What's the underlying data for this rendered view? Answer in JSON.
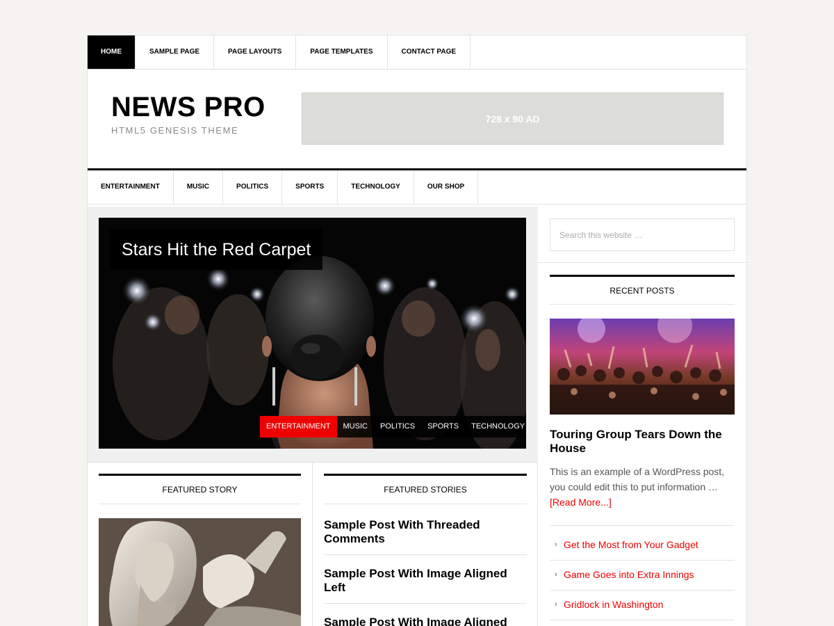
{
  "top_nav": {
    "items": [
      {
        "label": "HOME"
      },
      {
        "label": "SAMPLE PAGE"
      },
      {
        "label": "PAGE LAYOUTS"
      },
      {
        "label": "PAGE TEMPLATES"
      },
      {
        "label": "CONTACT PAGE"
      }
    ]
  },
  "header": {
    "title": "NEWS PRO",
    "tagline": "HTML5 GENESIS THEME",
    "ad_label": "728 x 90 AD"
  },
  "secondary_nav": {
    "items": [
      {
        "label": "ENTERTAINMENT"
      },
      {
        "label": "MUSIC"
      },
      {
        "label": "POLITICS"
      },
      {
        "label": "SPORTS"
      },
      {
        "label": "TECHNOLOGY"
      },
      {
        "label": "OUR SHOP"
      }
    ]
  },
  "hero": {
    "title": "Stars Hit the Red Carpet",
    "tabs": [
      {
        "label": "ENTERTAINMENT"
      },
      {
        "label": "MUSIC"
      },
      {
        "label": "POLITICS"
      },
      {
        "label": "SPORTS"
      },
      {
        "label": "TECHNOLOGY"
      }
    ]
  },
  "featured_story": {
    "title": "FEATURED STORY"
  },
  "featured_stories": {
    "title": "FEATURED STORIES",
    "items": [
      {
        "title": "Sample Post With Threaded Comments"
      },
      {
        "title": "Sample Post With Image Aligned Left"
      },
      {
        "title": "Sample Post With Image Aligned"
      }
    ]
  },
  "sidebar": {
    "search_placeholder": "Search this website …",
    "recent_posts_title": "RECENT POSTS",
    "post_title": "Touring Group Tears Down the House",
    "post_excerpt": "This is an example of a WordPress post, you could edit this to put information …",
    "read_more": "[Read More...]",
    "links": [
      {
        "label": "Get the Most from Your Gadget"
      },
      {
        "label": "Game Goes into Extra Innings"
      },
      {
        "label": "Gridlock in Washington"
      }
    ]
  },
  "colors": {
    "accent": "#ee0000",
    "nav_active_bg": "#000000",
    "border": "#e2e2e2",
    "ad_bg": "#dcdcd9"
  }
}
